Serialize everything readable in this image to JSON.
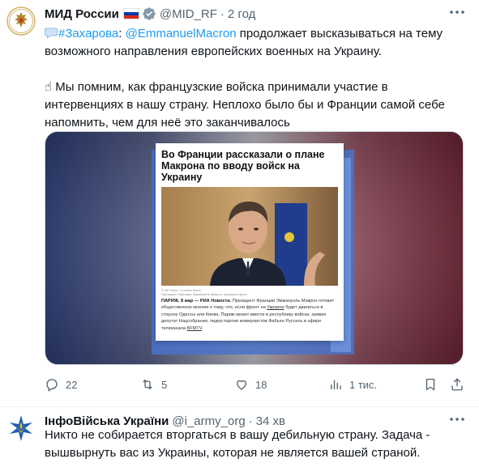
{
  "tweets": [
    {
      "author": {
        "name": "МИД России",
        "handle": "@MID_RF",
        "separator": "·",
        "time": "2 год",
        "flag_colors": [
          "#ffffff",
          "#0039a6",
          "#d52b1e"
        ],
        "badge_color": "#829aab"
      },
      "text": {
        "hashtag": "#Захарова",
        "mention": "@EmmanuelMacron",
        "line1_rest": " продолжает высказываться на тему возможного направления европейских военных на Украину.",
        "line2": "☝ Мы помним, как французские войска принимали участие в интервенциях в нашу страну. Неплохо было бы и Франции самой себе напомнить, чем для неё это заканчивалось",
        "speech_icon": "speech-bubble-icon"
      },
      "media": {
        "title": "Во Франции рассказали о плане Макрона по вводу войск на Украину",
        "photo_caption_1": "© AP Photo / Ludovic Marin",
        "photo_caption_2": "Президент Франции Эммануэль Макрон. Архивное фото",
        "body_lead": "ПАРИЖ, 8 мар — РИА Новости.",
        "body_1": " Президент Франции Эммануэль Макрон готовит общественное мнение к тому, что, если фронт на ",
        "body_link1": "Украине",
        "body_2": " будет двигаться в сторону Одессы или Киева, Париж может ввести в республику войска, заявил депутат Нацсобрания, лидер партии коммунистов Фабьен Руссель в эфире телеканала ",
        "body_link2": "BFMTV",
        "body_3": "."
      },
      "actions": {
        "replies": "22",
        "reposts": "5",
        "likes": "18",
        "views": "1 тис."
      }
    },
    {
      "author": {
        "name": "ІнфоВійська України",
        "handle": "@i_army_org",
        "separator": "·",
        "time": "34 хв"
      },
      "text": {
        "body": "Никто не собирается вторгаться в вашу дебильную страну. Задача - вышвырнуть вас из Украины, которая не является вашей страной."
      }
    }
  ],
  "colors": {
    "accent": "#1d9bf0",
    "muted": "#536471"
  }
}
